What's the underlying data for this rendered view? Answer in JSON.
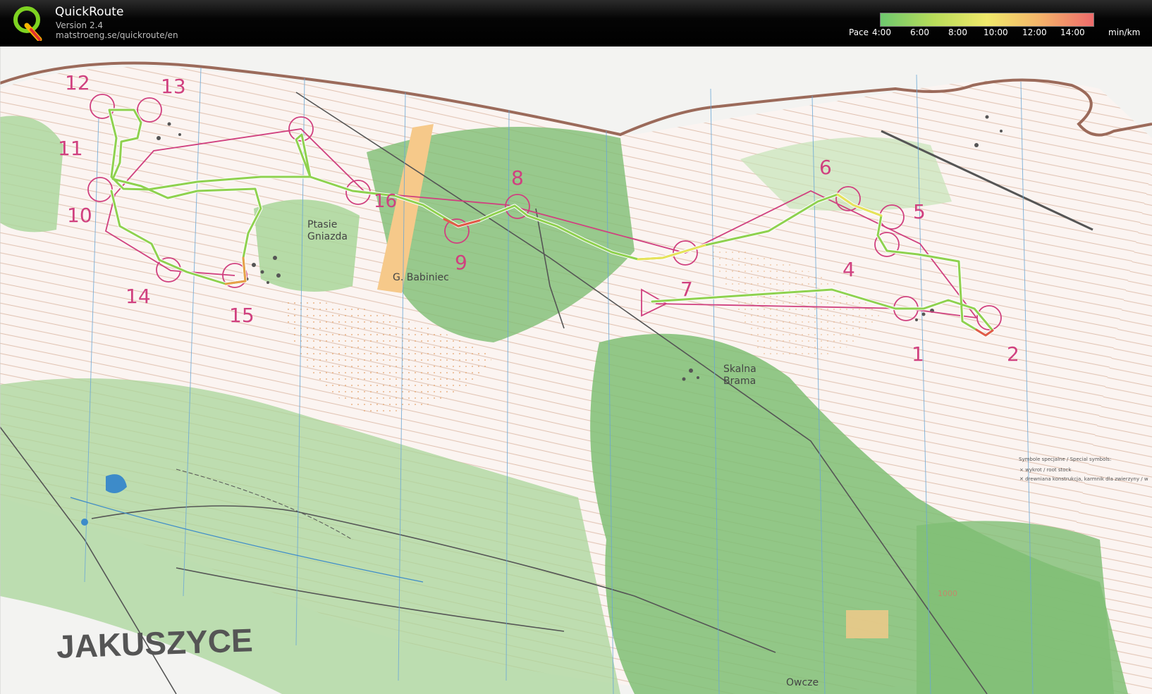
{
  "app": {
    "title": "QuickRoute",
    "version": "Version 2.4",
    "url": "matstroeng.se/quickroute/en"
  },
  "pace_legend": {
    "label": "Pace",
    "ticks": [
      "4:00",
      "6:00",
      "8:00",
      "10:00",
      "12:00",
      "14:00"
    ],
    "unit": "min/km",
    "colors": [
      "#6ec86e",
      "#b8dc5a",
      "#f0e96a",
      "#f4b36a",
      "#ee6b6b"
    ]
  },
  "map": {
    "title": "JAKUSZYCE",
    "place_names": [
      "Ptasie",
      "Gniazda",
      "G. Babiniec",
      "Skalna",
      "Brama",
      "Owcze"
    ],
    "control_numbers": [
      "1",
      "2",
      "4",
      "5",
      "6",
      "7",
      "8",
      "9",
      "10",
      "11",
      "12",
      "13",
      "14",
      "15"
    ],
    "legend": {
      "title": "Symbole specjalne / Special symbols:",
      "items": [
        "wykrot / root stock",
        "drewniana konstrukcja, karmnik dla zwierzyny / w"
      ]
    },
    "spot_height": "1000",
    "colors": {
      "forest_green": "#6fb56a",
      "light_green": "#a9d69a",
      "open_yellow": "#f6c98a",
      "contour_brown": "#c08a6a",
      "course_magenta": "#d0407f",
      "road_brown": "#9b6a5a",
      "water_blue": "#3d8bc9",
      "route_green": "#8fd14f"
    }
  }
}
